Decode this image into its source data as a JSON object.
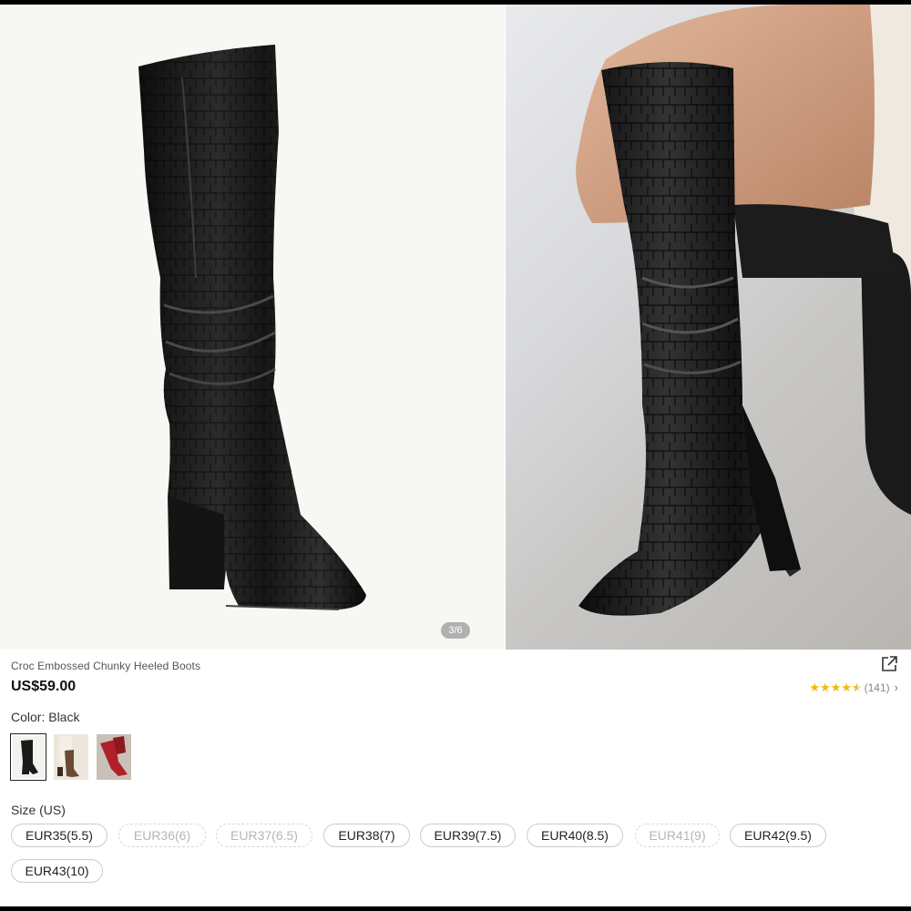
{
  "gallery": {
    "page_indicator": "3/6"
  },
  "product": {
    "title": "Croc Embossed Chunky Heeled Boots",
    "price": "US$59.00",
    "rating": {
      "stars": 4.5,
      "count_label": "(141)"
    }
  },
  "color": {
    "label": "Color: Black",
    "options": [
      {
        "name": "Black",
        "selected": true
      },
      {
        "name": "Brown",
        "selected": false
      },
      {
        "name": "Red",
        "selected": false
      }
    ]
  },
  "size": {
    "label": "Size (US)",
    "options": [
      {
        "label": "EUR35(5.5)",
        "available": true
      },
      {
        "label": "EUR36(6)",
        "available": false
      },
      {
        "label": "EUR37(6.5)",
        "available": false
      },
      {
        "label": "EUR38(7)",
        "available": true
      },
      {
        "label": "EUR39(7.5)",
        "available": true
      },
      {
        "label": "EUR40(8.5)",
        "available": true
      },
      {
        "label": "EUR41(9)",
        "available": false
      },
      {
        "label": "EUR42(9.5)",
        "available": true
      },
      {
        "label": "EUR43(10)",
        "available": true
      }
    ]
  },
  "icons": {
    "share": "share-icon",
    "chevron": "chevron-right-icon"
  },
  "colors": {
    "star": "#f5b700",
    "price": "#111111"
  }
}
